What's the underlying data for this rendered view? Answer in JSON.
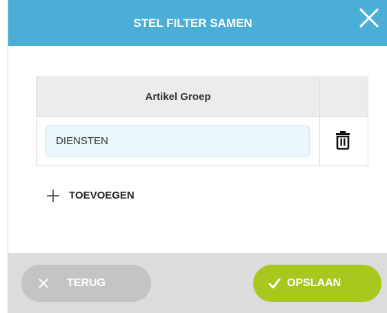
{
  "dialog": {
    "title": "STEL FILTER SAMEN",
    "close_icon": "close-icon"
  },
  "table": {
    "column_header": "Artikel Groep",
    "rows": [
      {
        "value": "DIENSTEN",
        "action_icon": "trash-icon"
      }
    ]
  },
  "add": {
    "icon": "plus-icon",
    "label": "TOEVOEGEN"
  },
  "footer": {
    "back": {
      "icon": "close-icon",
      "label": "TERUG"
    },
    "save": {
      "icon": "checkmark-icon",
      "label": "OPSLAAN"
    }
  },
  "colors": {
    "header": "#4aaed6",
    "save_button": "#a8c81f",
    "back_button": "#c4c4c4",
    "footer": "#dcdcdc",
    "field": "#e9f7fc"
  }
}
